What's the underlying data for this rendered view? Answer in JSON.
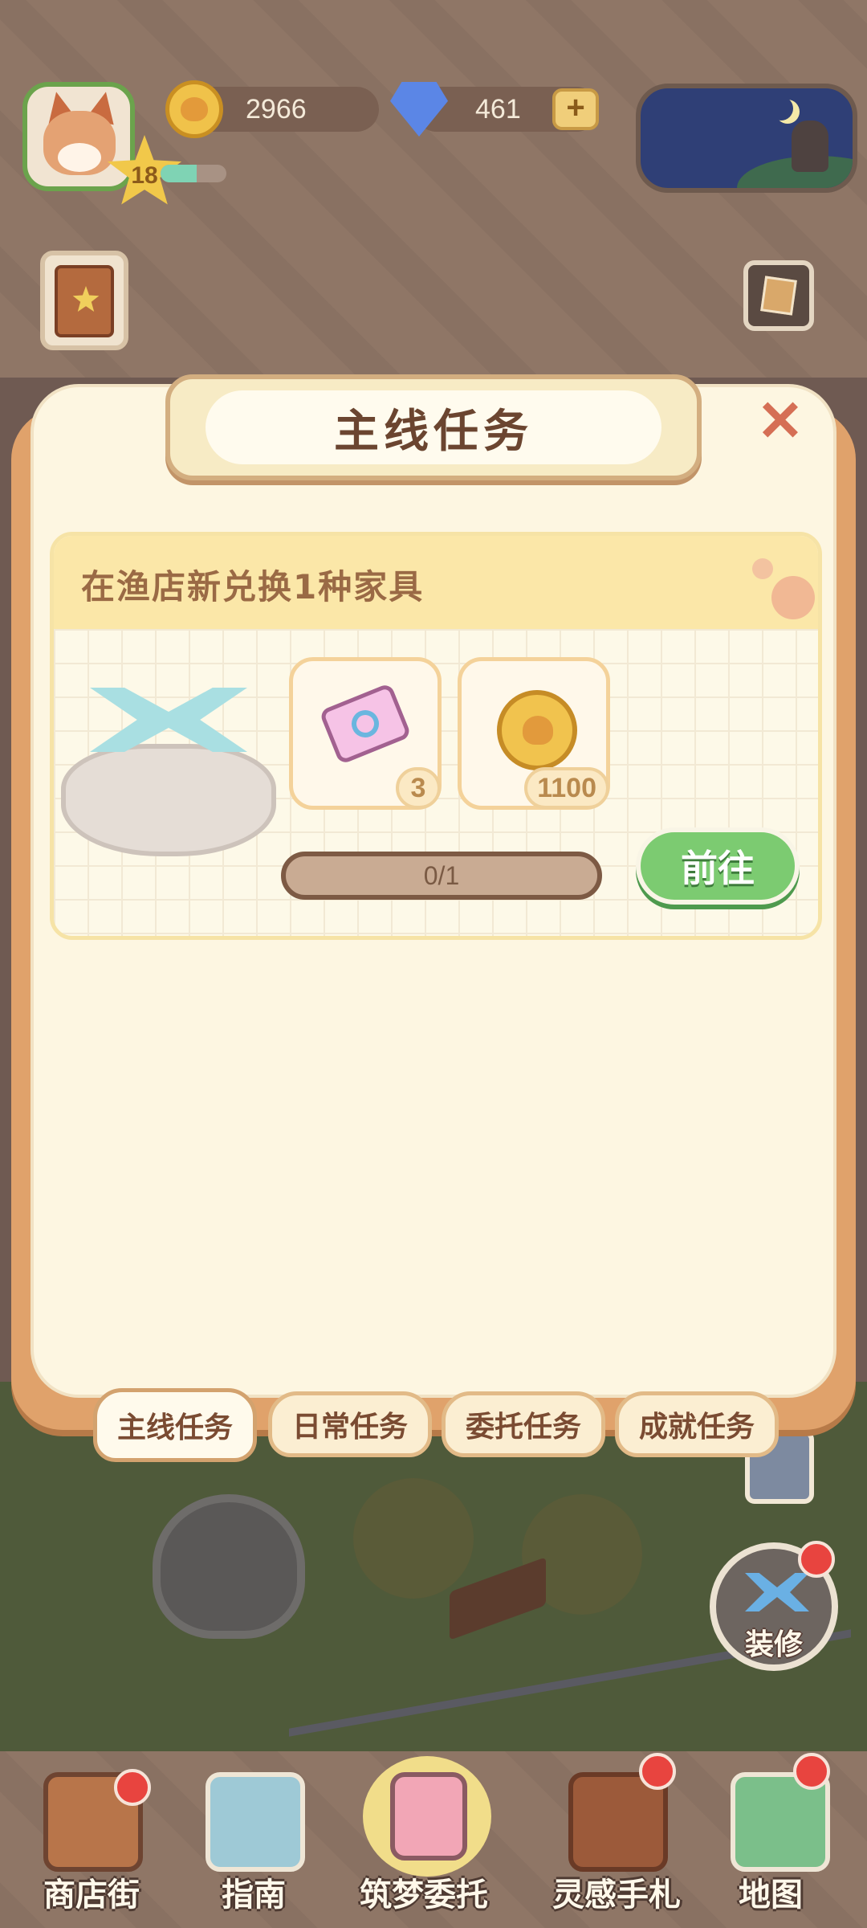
{
  "hud": {
    "level": "18",
    "xp_fraction": 0.55,
    "coins": "2966",
    "gems": "461",
    "plus_label": "+"
  },
  "panel": {
    "title": "主线任务",
    "close_label": "✕"
  },
  "quest": {
    "title": "在渔店新兑换1种家具",
    "rewards": [
      {
        "icon": "ticket-icon",
        "qty": "3"
      },
      {
        "icon": "coin-icon",
        "qty": "1100"
      }
    ],
    "progress_text": "0/1",
    "progress_fraction": 0,
    "go_label": "前往"
  },
  "tabs": [
    {
      "label": "主线任务",
      "active": true
    },
    {
      "label": "日常任务",
      "active": false
    },
    {
      "label": "委托任务",
      "active": false
    },
    {
      "label": "成就任务",
      "active": false
    }
  ],
  "decorate": {
    "label": "装修"
  },
  "bottom_nav": [
    {
      "label": "商店街",
      "icon": "shop-icon",
      "badge": true
    },
    {
      "label": "指南",
      "icon": "guide-icon",
      "badge": false
    },
    {
      "label": "筑梦委托",
      "icon": "notebook-icon",
      "badge": false
    },
    {
      "label": "灵感手札",
      "icon": "journal-icon",
      "badge": true
    },
    {
      "label": "地图",
      "icon": "map-icon",
      "badge": true
    }
  ],
  "colors": {
    "accent_green": "#7ccb71",
    "panel_bg": "#fdf6e1",
    "badge_red": "#e8443f"
  }
}
